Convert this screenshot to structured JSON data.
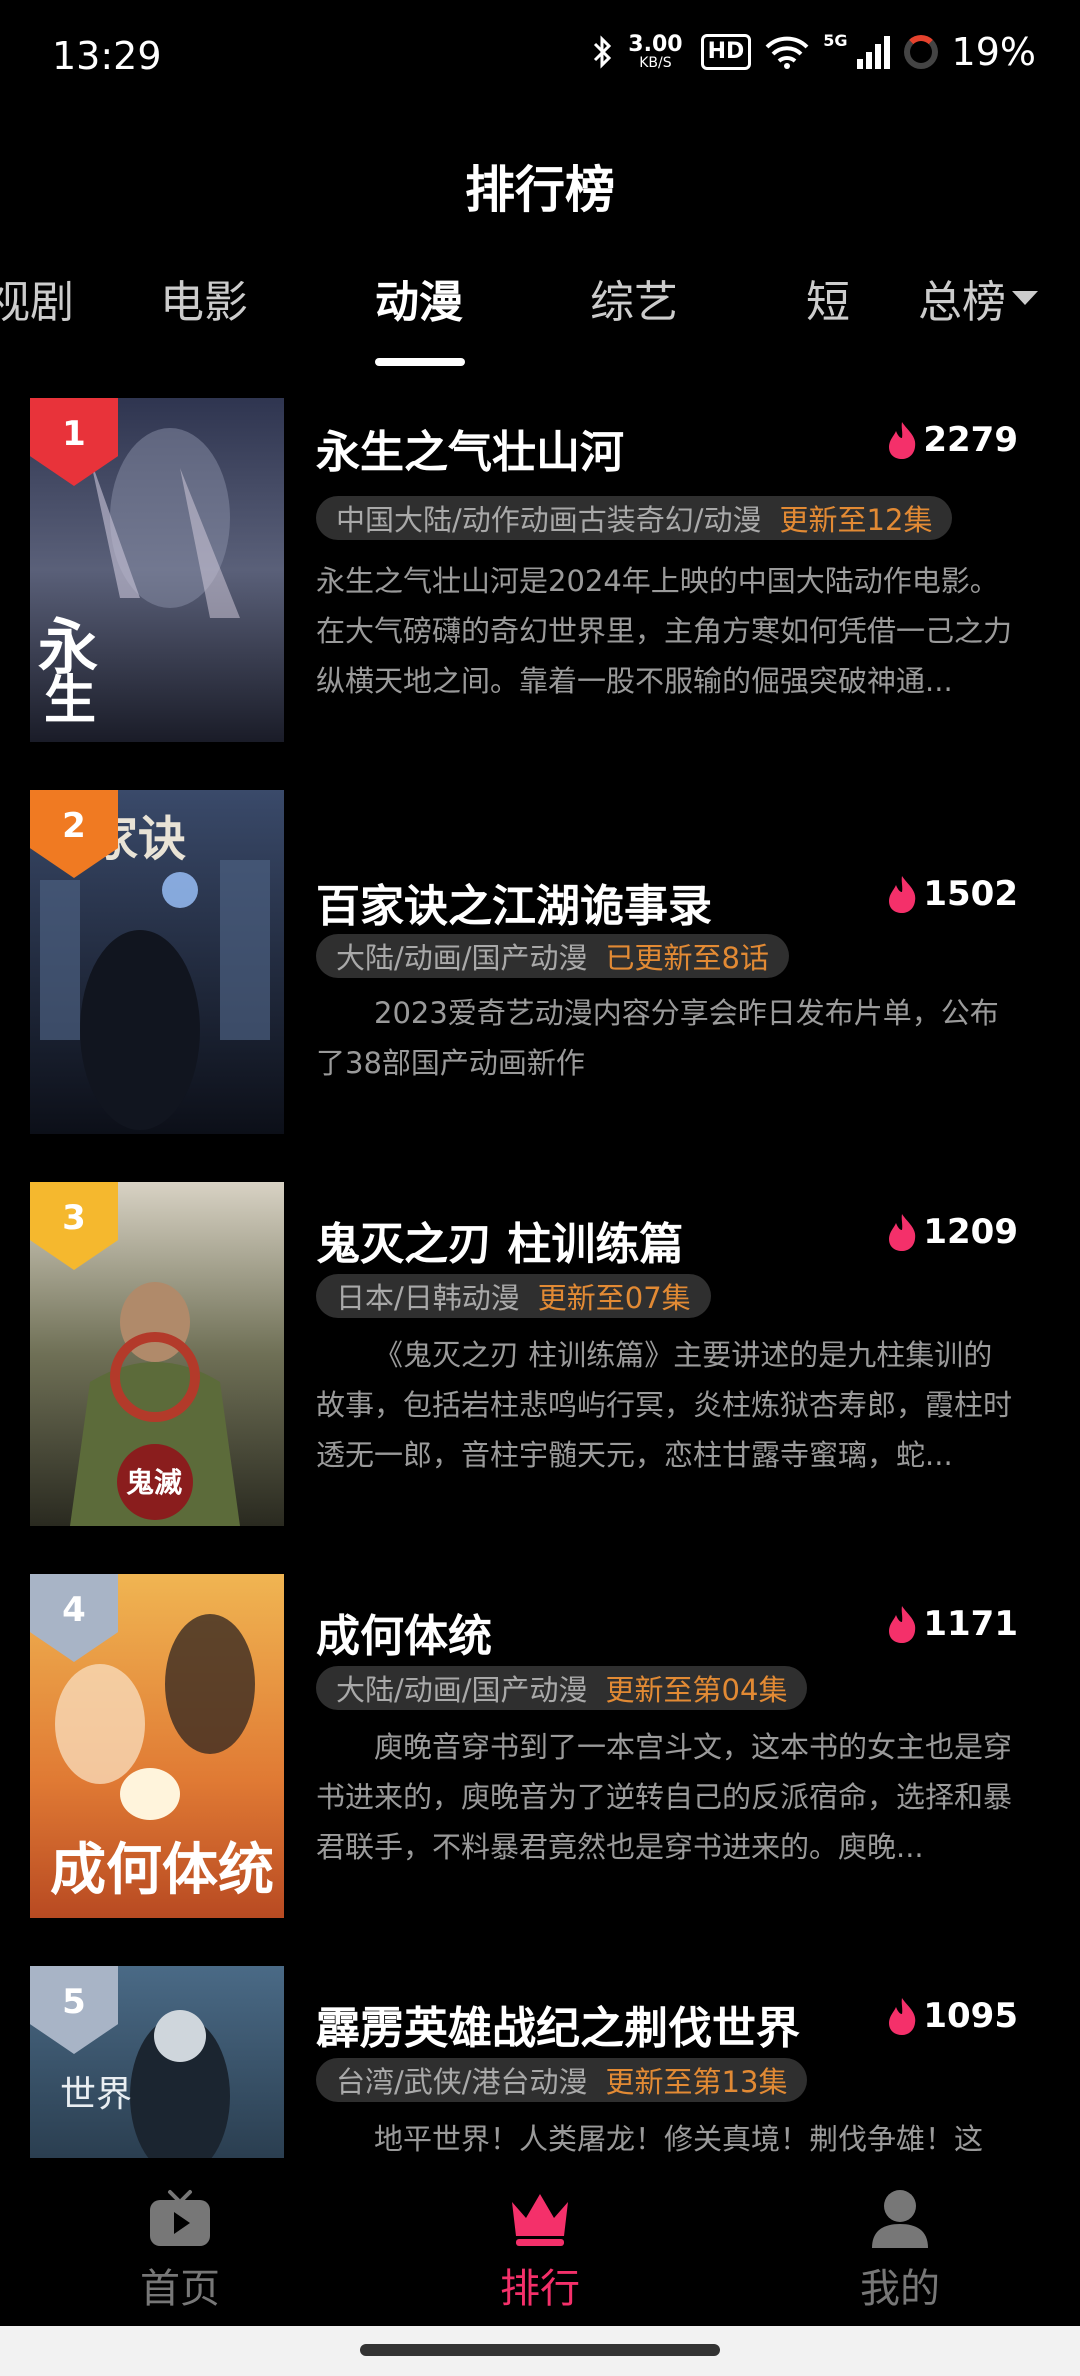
{
  "status": {
    "time": "13:29",
    "speed_value": "3.00",
    "speed_unit": "KB/S",
    "hd": "HD",
    "network": "5G",
    "battery": "19%"
  },
  "title": "排行榜",
  "tabs": [
    "视剧",
    "电影",
    "动漫",
    "综艺",
    "短"
  ],
  "active_tab": "动漫",
  "sort_label": "总榜",
  "items": [
    {
      "rank": "1",
      "rank_color": "#e8333a",
      "title": "永生之气壮山河",
      "heat": "2279",
      "tags": "中国大陆/动作动画古装奇幻/动漫",
      "update": "更新至12集",
      "desc": "永生之气壮山河是2024年上映的中国大陆动作电影。在大气磅礴的奇幻世界里，主角方寒如何凭借一己之力纵横天地之间。靠着一股不服输的倔强突破神通..."
    },
    {
      "rank": "2",
      "rank_color": "#f07a22",
      "title": "百家诀之江湖诡事录",
      "heat": "1502",
      "tags": "大陆/动画/国产动漫",
      "update": "已更新至8话",
      "desc": "2023爱奇艺动漫内容分享会昨日发布片单，公布了38部国产动画新作"
    },
    {
      "rank": "3",
      "rank_color": "#f5b82e",
      "title": "鬼灭之刃 柱训练篇",
      "heat": "1209",
      "tags": "日本/日韩动漫",
      "update": "更新至07集",
      "desc": "《鬼灭之刃 柱训练篇》主要讲述的是九柱集训的故事，包括岩柱悲鸣屿行冥，炎柱炼狱杏寿郎，霞柱时透无一郎，音柱宇髄天元，恋柱甘露寺蜜璃，蛇..."
    },
    {
      "rank": "4",
      "rank_color": "#a8b4c6",
      "title": "成何体统",
      "heat": "1171",
      "tags": "大陆/动画/国产动漫",
      "update": "更新至第04集",
      "desc": "庾晚音穿书到了一本宫斗文，这本书的女主也是穿书进来的，庾晚音为了逆转自己的反派宿命，选择和暴君联手，不料暴君竟然也是穿书进来的。庾晚..."
    },
    {
      "rank": "5",
      "rank_color": "#a8b4c6",
      "title": "霹雳英雄战纪之刜伐世界",
      "heat": "1095",
      "tags": "台湾/武侠/港台动漫",
      "update": "更新至第13集",
      "desc": "地平世界！人类屠龙！修关真境！刜伐争雄！这"
    }
  ],
  "nav": [
    {
      "label": "首页",
      "icon": "tv-play-icon"
    },
    {
      "label": "排行",
      "icon": "crown-icon"
    },
    {
      "label": "我的",
      "icon": "person-icon"
    }
  ],
  "active_nav": "排行",
  "colors": {
    "accent": "#f4306a",
    "update_text": "#e28a34",
    "heat_flame": "#f4306a"
  }
}
